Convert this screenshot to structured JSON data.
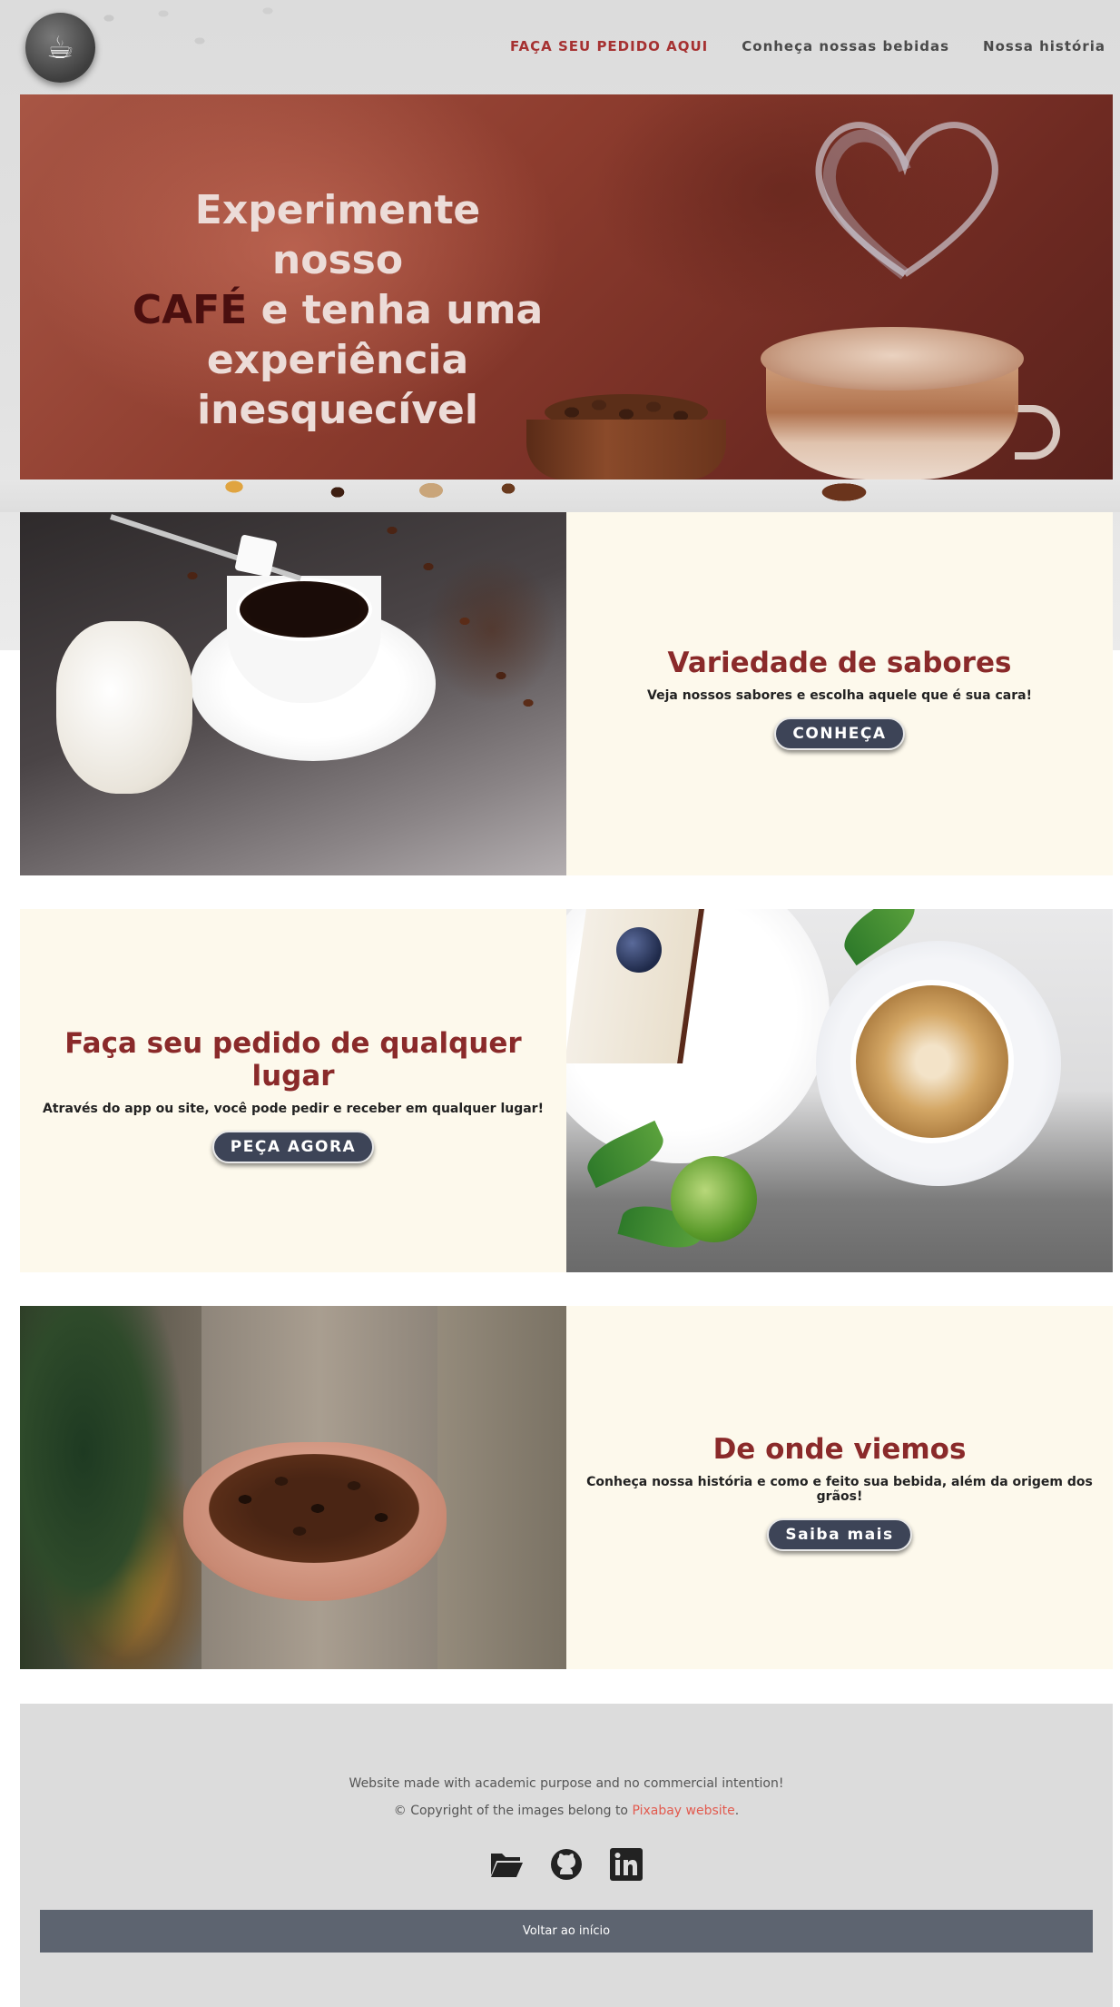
{
  "header": {
    "logo_icon": "coffee-cup-icon",
    "nav": [
      {
        "label": "FAÇA SEU PEDIDO AQUI",
        "accent": true
      },
      {
        "label": "Conheça nossas bebidas",
        "accent": false
      },
      {
        "label": "Nossa história",
        "accent": false
      }
    ]
  },
  "hero": {
    "line1": "Experimente nosso",
    "cafe_word": "CAFÉ",
    "line2_rest": " e tenha uma",
    "line3": "experiência",
    "line4": "inesquecível"
  },
  "sections": [
    {
      "title": "Variedade de sabores",
      "text": "Veja nossos sabores e escolha aquele que é sua cara!",
      "button": "CONHEÇA"
    },
    {
      "title": "Faça seu pedido de qualquer lugar",
      "text": "Através do app ou site, você pode pedir e receber em qualquer lugar!",
      "button": "PEÇA AGORA"
    },
    {
      "title": "De onde viemos",
      "text": "Conheça nossa história e como e feito sua bebida, além da origem dos grãos!",
      "button": "Saiba mais"
    }
  ],
  "footer": {
    "line1": "Website made with academic purpose and no commercial intention!",
    "copyright_prefix": "© Copyright of the images belong to ",
    "copyright_link": "Pixabay website",
    "copyright_suffix": ".",
    "social_icons": [
      "folder-icon",
      "github-icon",
      "linkedin-icon"
    ],
    "back_button": "Voltar ao início"
  },
  "colors": {
    "accent_red": "#a63232",
    "title_red": "#8a2a2a",
    "button_dark": "#3d4457",
    "panel_cream": "#fdf9ec",
    "footer_bg": "#dcdcdc",
    "footer_button": "#5d6470",
    "link": "#e25a4e"
  }
}
